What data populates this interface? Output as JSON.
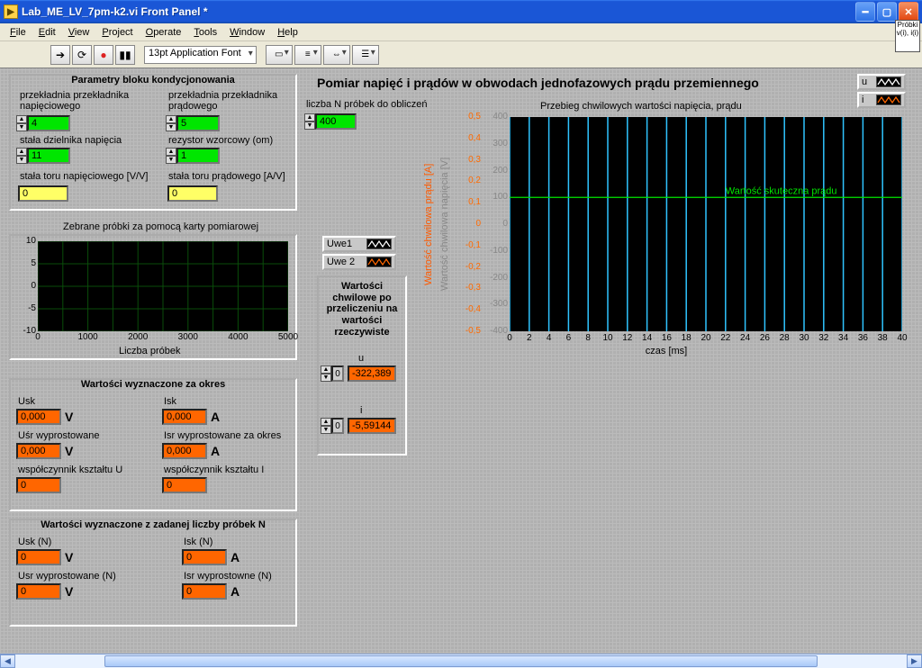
{
  "window": {
    "title": "Lab_ME_LV_7pm-k2.vi Front Panel *"
  },
  "menu": {
    "file": "File",
    "edit": "Edit",
    "view": "View",
    "project": "Project",
    "operate": "Operate",
    "tools": "Tools",
    "window": "Window",
    "help": "Help"
  },
  "toolbar": {
    "font": "13pt Application Font"
  },
  "probki_box": "Próbki\nv(i), i(i)",
  "main_title": "Pomiar napięć i prądów w obwodach jednofazowych prądu przemiennego",
  "params": {
    "title": "Parametry bloku kondycjonowania",
    "l1": "przekładnia przekładnika napięciowego",
    "v1": "4",
    "l2": "przekładnia przekładnika prądowego",
    "v2": "5",
    "l3": "stała dzielnika napięcia",
    "v3": "11",
    "l4": "rezystor wzorcowy (om)",
    "v4": "1",
    "l5": "stała toru napięciowego [V/V]",
    "v5": "0",
    "l6": "stała toru prądowego [A/V]",
    "v6": "0"
  },
  "samples_chart": {
    "title": "Zebrane próbki za pomocą karty pomiarowej",
    "xlabel": "Liczba próbek",
    "legend": [
      "Uwe1",
      "Uwe 2"
    ]
  },
  "n_samples": {
    "label": "liczba N próbek do obliczeń",
    "value": "400"
  },
  "inst": {
    "title": "Wartości chwilowe po przeliczeniu na wartości rzeczywiste",
    "u_label": "u",
    "u_idx": "0",
    "u_val": "-322,389",
    "i_label": "i",
    "i_idx": "0",
    "i_val": "-5,59144"
  },
  "period": {
    "title": "Wartości wyznaczone za okres",
    "usk": "Usk",
    "usk_v": "0,000",
    "usk_u": "V",
    "isk": "Isk",
    "isk_v": "0,000",
    "isk_u": "A",
    "usr": "Uśr wyprostowane",
    "usr_v": "0,000",
    "usr_u": "V",
    "isr": "Isr wyprostowane za okres",
    "isr_v": "0,000",
    "isr_u": "A",
    "ku": "współczynnik kształtu U",
    "ku_v": "0",
    "ki": "współczynnik kształtu I",
    "ki_v": "0"
  },
  "n_vals": {
    "title": "Wartości wyznaczone z zadanej liczby próbek N",
    "usk": "Usk (N)",
    "usk_v": "0",
    "usk_u": "V",
    "isk": "Isk (N)",
    "isk_v": "0",
    "isk_u": "A",
    "usr": "Usr wyprostowane (N)",
    "usr_v": "0",
    "usr_u": "V",
    "isr": "Isr wyprostowne (N)",
    "isr_v": "0",
    "isr_u": "A"
  },
  "big_chart": {
    "title": "Przebieg chwilowych wartości napięcia, prądu",
    "xlabel": "czas [ms]",
    "ylabel_left": "Wartość chwilowa prądu [A]",
    "ylabel_right": "Wartość chwilowa napięcia [V]",
    "annotation": "Wartość skuteczna prądu",
    "legend_u": "u",
    "legend_i": "i"
  },
  "chart_data": [
    {
      "type": "line",
      "title": "Zebrane próbki za pomocą karty pomiarowej",
      "xlabel": "Liczba próbek",
      "ylabel": "",
      "xlim": [
        0,
        5000
      ],
      "ylim": [
        -10,
        10
      ],
      "x_ticks": [
        0,
        1000,
        2000,
        3000,
        4000,
        5000
      ],
      "y_ticks": [
        -10,
        -5,
        0,
        5,
        10
      ],
      "series": [
        {
          "name": "Uwe1",
          "values": []
        },
        {
          "name": "Uwe 2",
          "values": []
        }
      ]
    },
    {
      "type": "line",
      "title": "Przebieg chwilowych wartości napięcia, prądu",
      "xlabel": "czas [ms]",
      "x": [
        0,
        2,
        4,
        6,
        8,
        10,
        12,
        14,
        16,
        18,
        20,
        22,
        24,
        26,
        28,
        30,
        32,
        34,
        36,
        38,
        40
      ],
      "xlim": [
        0,
        40
      ],
      "y_left": {
        "label": "Wartość chwilowa prądu [A]",
        "lim": [
          -0.5,
          0.5
        ],
        "ticks": [
          -0.5,
          -0.4,
          -0.3,
          -0.2,
          -0.1,
          0,
          0.1,
          0.2,
          0.3,
          0.4,
          0.5
        ]
      },
      "y_right": {
        "label": "Wartość chwilowa napięcia [V]",
        "lim": [
          -400,
          400
        ],
        "ticks": [
          -400,
          -300,
          -200,
          -100,
          0,
          100,
          200,
          300,
          400
        ]
      },
      "annotation": {
        "text": "Wartość skuteczna prądu",
        "y_right": 100
      },
      "series": [
        {
          "name": "u",
          "axis": "right",
          "style": "spikes",
          "spike_x": [
            0,
            2,
            4,
            6,
            8,
            10,
            12,
            14,
            16,
            18,
            20,
            22,
            24,
            26,
            28,
            30,
            32,
            34,
            36,
            38,
            40
          ]
        },
        {
          "name": "i",
          "axis": "left",
          "values": []
        }
      ]
    }
  ]
}
